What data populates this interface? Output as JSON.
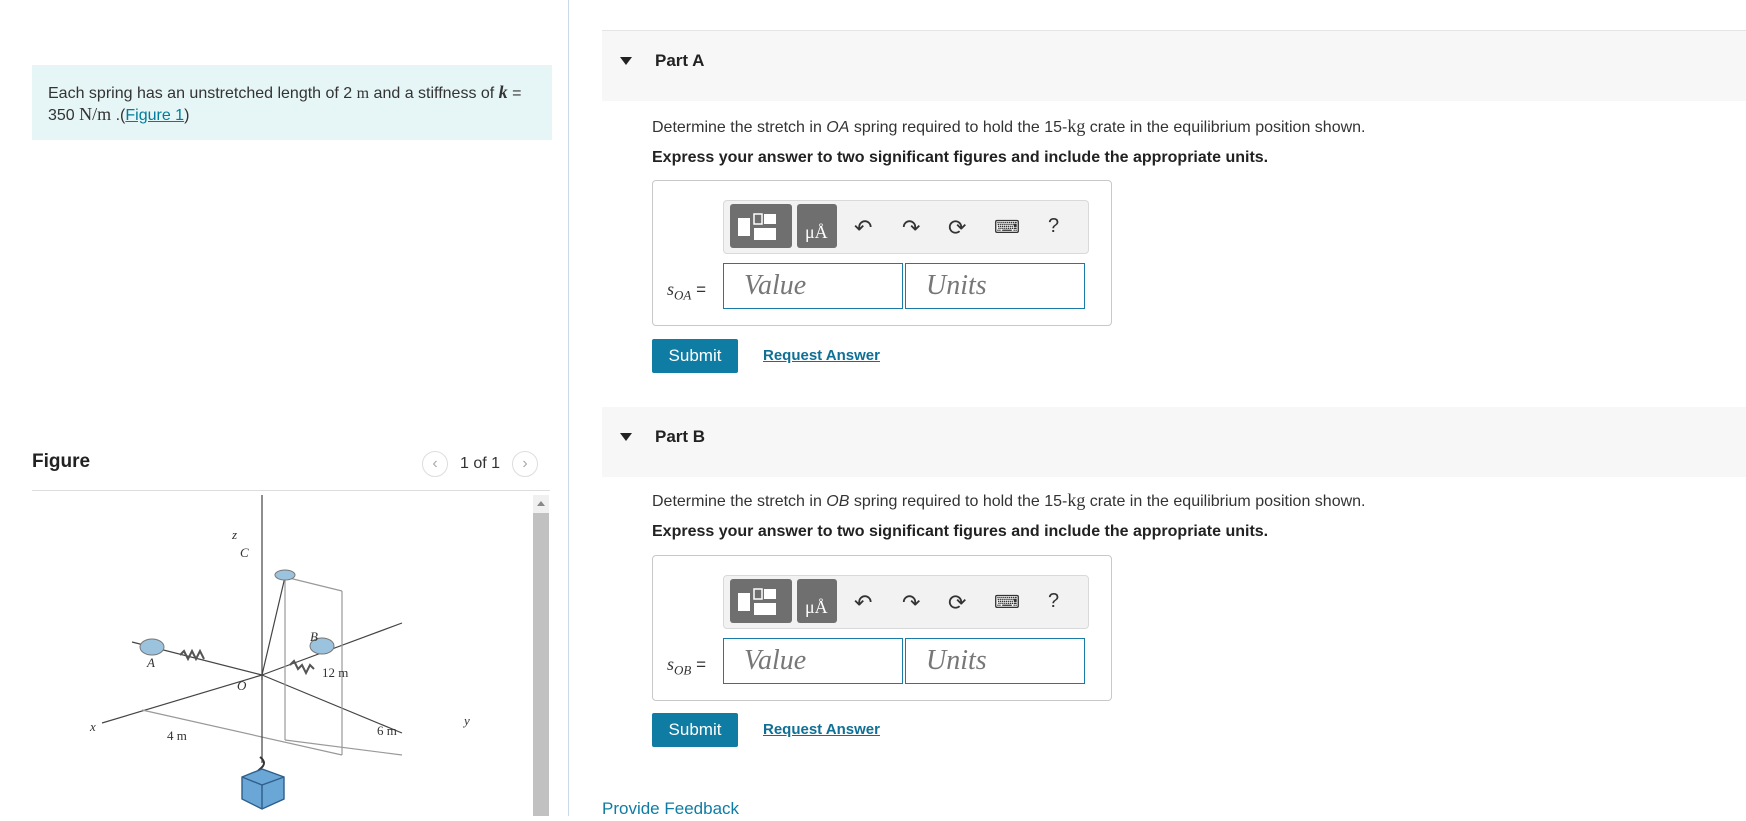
{
  "problem": {
    "text_before": "Each spring has an unstretched length of 2 ",
    "unit_m": "m",
    "text_mid": " and a stiffness of ",
    "k_symbol": "k",
    "text_eq": " =",
    "value_350": "350 ",
    "unit_nm": "N/m",
    "text_dot": " .(",
    "figure_link": "Figure 1",
    "text_close": ")"
  },
  "figure": {
    "title": "Figure",
    "pager_text": "1 of 1",
    "prev_icon": "chevron-left-icon",
    "next_icon": "chevron-right-icon",
    "labels": {
      "z": "z",
      "c": "C",
      "b": "B",
      "a": "A",
      "o": "O",
      "x": "x",
      "y": "y",
      "dim12": "12 m",
      "dim4": "4 m",
      "dim6": "6 m"
    }
  },
  "partA": {
    "title": "Part A",
    "question_pre": "Determine the stretch in ",
    "spring": "OA",
    "question_mid": " spring required to hold the 15-",
    "unit_kg": "kg",
    "question_post": " crate in the equilibrium position shown.",
    "instructions": "Express your answer to two significant figures and include the appropriate units.",
    "var_main": "s",
    "var_sub": "OA",
    "eq": " =",
    "value_placeholder": "Value",
    "units_placeholder": "Units",
    "submit": "Submit",
    "request": "Request Answer",
    "mu_label": "μÅ",
    "help": "?"
  },
  "partB": {
    "title": "Part B",
    "question_pre": "Determine the stretch in ",
    "spring": "OB",
    "question_mid": " spring required to hold the 15-",
    "unit_kg": "kg",
    "question_post": " crate in the equilibrium position shown.",
    "instructions": "Express your answer to two significant figures and include the appropriate units.",
    "var_main": "s",
    "var_sub": "OB",
    "eq": " =",
    "value_placeholder": "Value",
    "units_placeholder": "Units",
    "submit": "Submit",
    "request": "Request Answer",
    "mu_label": "μÅ",
    "help": "?"
  },
  "footer": {
    "feedback": "Provide Feedback"
  },
  "colors": {
    "accent": "#0f7ca4",
    "problem_bg": "#e6f5f5",
    "link": "#007c9c"
  }
}
